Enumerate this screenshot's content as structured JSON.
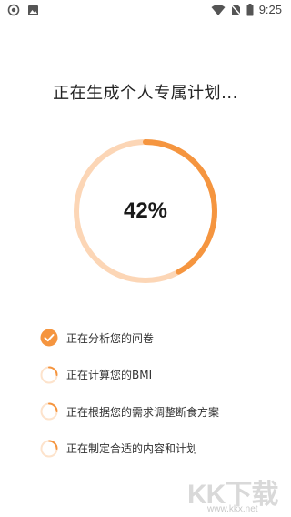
{
  "status_bar": {
    "time": "9:25",
    "icons": [
      "record-icon",
      "image-icon",
      "wifi-icon",
      "no-sim-icon",
      "battery-icon"
    ]
  },
  "title": "正在生成个人专属计划...",
  "progress": {
    "value": 0.42,
    "label": "42%",
    "accent_color": "#f5953f",
    "track_color": "#fcd6b6"
  },
  "steps": [
    {
      "label": "正在分析您的问卷",
      "done": true
    },
    {
      "label": "正在计算您的BMI",
      "done": false
    },
    {
      "label": "正在根据您的需求调整断食方案",
      "done": false
    },
    {
      "label": "正在制定合适的内容和计划",
      "done": false
    }
  ],
  "watermark": {
    "logo": "KK下载",
    "url": "www.kkx.net"
  }
}
